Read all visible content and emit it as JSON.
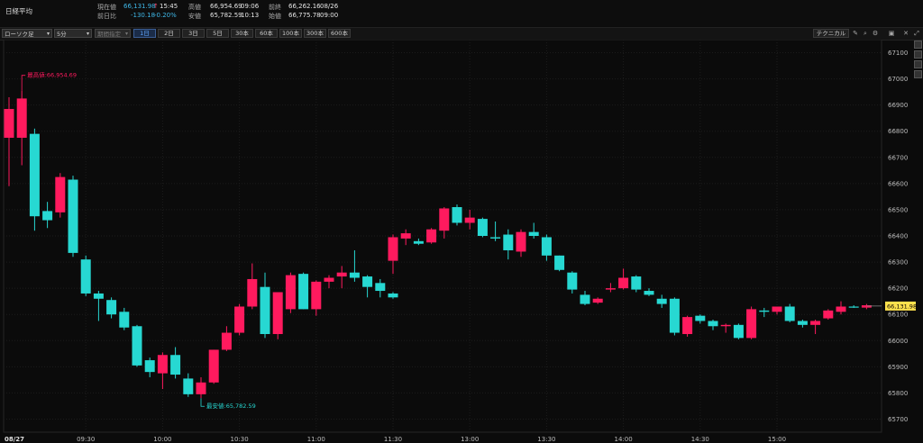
{
  "header": {
    "title": "日経平均",
    "current_label": "現在値",
    "current_value": "66,131.98",
    "current_arrow": "↑",
    "current_time": "15:45",
    "change_label": "前日比",
    "change_value": "-130.18",
    "change_pct": "-0.20%",
    "high_label": "高値",
    "high_value": "66,954.69",
    "high_time": "09:06",
    "low_label": "安値",
    "low_value": "65,782.59",
    "low_time": "10:13",
    "prev_label": "前終",
    "prev_value": "66,262.16",
    "prev_date": "08/26",
    "open_label": "始値",
    "open_value": "66,775.78",
    "open_time": "09:00"
  },
  "toolbar": {
    "chart_type": "ローソク足",
    "interval": "5分",
    "period": "期間指定",
    "ranges": [
      "1日",
      "2日",
      "3日",
      "5日",
      "30本",
      "60本",
      "100本",
      "300本",
      "600本"
    ],
    "active_range": "1日",
    "technical": "テクニカル"
  },
  "colors": {
    "up": "#ff1a5e",
    "down": "#27d8d2",
    "bg": "#0b0b0b",
    "grid": "#1c1c1c",
    "price_tag": "#ffe14d"
  },
  "chart_data": {
    "type": "candlestick",
    "date_label": "08/27",
    "x_ticks": [
      "09:30",
      "10:00",
      "10:30",
      "11:00",
      "11:30",
      "13:00",
      "13:30",
      "14:00",
      "14:30",
      "15:00"
    ],
    "y_ticks": [
      65700,
      65800,
      65900,
      66000,
      66100,
      66200,
      66300,
      66400,
      66500,
      66600,
      66700,
      66800,
      66900,
      67000,
      67100
    ],
    "ylim": [
      65650,
      67150
    ],
    "last_price_label": "66,131.98",
    "last_price": 66131.98,
    "high_annotation": "最高値:66,954.69",
    "low_annotation": "最安値:65,782.59",
    "candles": [
      {
        "t": "09:00",
        "o": 66775,
        "h": 66930,
        "l": 66590,
        "c": 66885
      },
      {
        "t": "09:05",
        "o": 66775,
        "h": 66955,
        "l": 66670,
        "c": 66925
      },
      {
        "t": "09:10",
        "o": 66790,
        "h": 66810,
        "l": 66420,
        "c": 66475
      },
      {
        "t": "09:15",
        "o": 66495,
        "h": 66530,
        "l": 66430,
        "c": 66460
      },
      {
        "t": "09:20",
        "o": 66490,
        "h": 66640,
        "l": 66470,
        "c": 66625
      },
      {
        "t": "09:25",
        "o": 66615,
        "h": 66630,
        "l": 66320,
        "c": 66335
      },
      {
        "t": "09:30",
        "o": 66310,
        "h": 66325,
        "l": 66170,
        "c": 66180
      },
      {
        "t": "09:35",
        "o": 66180,
        "h": 66190,
        "l": 66075,
        "c": 66160
      },
      {
        "t": "09:40",
        "o": 66155,
        "h": 66165,
        "l": 66085,
        "c": 66100
      },
      {
        "t": "09:45",
        "o": 66110,
        "h": 66125,
        "l": 66040,
        "c": 66050
      },
      {
        "t": "09:50",
        "o": 66055,
        "h": 66060,
        "l": 65900,
        "c": 65905
      },
      {
        "t": "09:55",
        "o": 65925,
        "h": 65935,
        "l": 65860,
        "c": 65880
      },
      {
        "t": "10:00",
        "o": 65875,
        "h": 65955,
        "l": 65815,
        "c": 65945
      },
      {
        "t": "10:05",
        "o": 65945,
        "h": 65975,
        "l": 65855,
        "c": 65870
      },
      {
        "t": "10:10",
        "o": 65855,
        "h": 65875,
        "l": 65785,
        "c": 65795
      },
      {
        "t": "10:15",
        "o": 65795,
        "h": 65860,
        "l": 65780,
        "c": 65840
      },
      {
        "t": "10:20",
        "o": 65840,
        "h": 65965,
        "l": 65835,
        "c": 65965
      },
      {
        "t": "10:25",
        "o": 65965,
        "h": 66055,
        "l": 65960,
        "c": 66030
      },
      {
        "t": "10:30",
        "o": 66030,
        "h": 66140,
        "l": 66020,
        "c": 66130
      },
      {
        "t": "10:35",
        "o": 66130,
        "h": 66295,
        "l": 66120,
        "c": 66235
      },
      {
        "t": "10:40",
        "o": 66205,
        "h": 66260,
        "l": 66010,
        "c": 66025
      },
      {
        "t": "10:45",
        "o": 66025,
        "h": 66185,
        "l": 66005,
        "c": 66185
      },
      {
        "t": "10:50",
        "o": 66120,
        "h": 66260,
        "l": 66105,
        "c": 66250
      },
      {
        "t": "10:55",
        "o": 66255,
        "h": 66260,
        "l": 66120,
        "c": 66120
      },
      {
        "t": "11:00",
        "o": 66120,
        "h": 66230,
        "l": 66095,
        "c": 66225
      },
      {
        "t": "11:05",
        "o": 66225,
        "h": 66250,
        "l": 66200,
        "c": 66240
      },
      {
        "t": "11:10",
        "o": 66245,
        "h": 66285,
        "l": 66200,
        "c": 66260
      },
      {
        "t": "11:15",
        "o": 66260,
        "h": 66345,
        "l": 66225,
        "c": 66240
      },
      {
        "t": "11:20",
        "o": 66245,
        "h": 66250,
        "l": 66165,
        "c": 66205
      },
      {
        "t": "11:25",
        "o": 66220,
        "h": 66235,
        "l": 66165,
        "c": 66190
      },
      {
        "t": "11:30",
        "o": 66180,
        "h": 66185,
        "l": 66160,
        "c": 66165
      },
      {
        "t": "12:30",
        "o": 66305,
        "h": 66405,
        "l": 66255,
        "c": 66395
      },
      {
        "t": "12:35",
        "o": 66390,
        "h": 66425,
        "l": 66365,
        "c": 66410
      },
      {
        "t": "12:40",
        "o": 66380,
        "h": 66390,
        "l": 66365,
        "c": 66370
      },
      {
        "t": "12:45",
        "o": 66375,
        "h": 66430,
        "l": 66370,
        "c": 66425
      },
      {
        "t": "12:50",
        "o": 66420,
        "h": 66510,
        "l": 66390,
        "c": 66505
      },
      {
        "t": "12:55",
        "o": 66510,
        "h": 66520,
        "l": 66440,
        "c": 66450
      },
      {
        "t": "13:00",
        "o": 66450,
        "h": 66500,
        "l": 66425,
        "c": 66470
      },
      {
        "t": "13:05",
        "o": 66465,
        "h": 66470,
        "l": 66395,
        "c": 66400
      },
      {
        "t": "13:10",
        "o": 66395,
        "h": 66455,
        "l": 66380,
        "c": 66390
      },
      {
        "t": "13:15",
        "o": 66405,
        "h": 66425,
        "l": 66310,
        "c": 66345
      },
      {
        "t": "13:20",
        "o": 66340,
        "h": 66425,
        "l": 66320,
        "c": 66415
      },
      {
        "t": "13:25",
        "o": 66415,
        "h": 66450,
        "l": 66390,
        "c": 66400
      },
      {
        "t": "13:30",
        "o": 66395,
        "h": 66405,
        "l": 66305,
        "c": 66325
      },
      {
        "t": "13:35",
        "o": 66325,
        "h": 66325,
        "l": 66265,
        "c": 66270
      },
      {
        "t": "13:40",
        "o": 66260,
        "h": 66265,
        "l": 66180,
        "c": 66195
      },
      {
        "t": "13:45",
        "o": 66175,
        "h": 66190,
        "l": 66135,
        "c": 66140
      },
      {
        "t": "13:50",
        "o": 66145,
        "h": 66165,
        "l": 66140,
        "c": 66160
      },
      {
        "t": "13:55",
        "o": 66195,
        "h": 66220,
        "l": 66185,
        "c": 66200
      },
      {
        "t": "14:00",
        "o": 66200,
        "h": 66275,
        "l": 66195,
        "c": 66240
      },
      {
        "t": "14:05",
        "o": 66245,
        "h": 66250,
        "l": 66185,
        "c": 66195
      },
      {
        "t": "14:10",
        "o": 66190,
        "h": 66200,
        "l": 66170,
        "c": 66175
      },
      {
        "t": "14:15",
        "o": 66160,
        "h": 66175,
        "l": 66125,
        "c": 66140
      },
      {
        "t": "14:20",
        "o": 66160,
        "h": 66165,
        "l": 66020,
        "c": 66030
      },
      {
        "t": "14:25",
        "o": 66025,
        "h": 66095,
        "l": 66015,
        "c": 66090
      },
      {
        "t": "14:30",
        "o": 66095,
        "h": 66100,
        "l": 66065,
        "c": 66075
      },
      {
        "t": "14:35",
        "o": 66075,
        "h": 66080,
        "l": 66040,
        "c": 66055
      },
      {
        "t": "14:40",
        "o": 66055,
        "h": 66065,
        "l": 66030,
        "c": 66060
      },
      {
        "t": "14:45",
        "o": 66060,
        "h": 66065,
        "l": 66005,
        "c": 66010
      },
      {
        "t": "14:50",
        "o": 66010,
        "h": 66130,
        "l": 66005,
        "c": 66120
      },
      {
        "t": "14:55",
        "o": 66115,
        "h": 66125,
        "l": 66090,
        "c": 66110
      },
      {
        "t": "15:00",
        "o": 66110,
        "h": 66130,
        "l": 66100,
        "c": 66130
      },
      {
        "t": "15:05",
        "o": 66130,
        "h": 66140,
        "l": 66070,
        "c": 66075
      },
      {
        "t": "15:10",
        "o": 66075,
        "h": 66080,
        "l": 66050,
        "c": 66060
      },
      {
        "t": "15:15",
        "o": 66060,
        "h": 66080,
        "l": 66025,
        "c": 66075
      },
      {
        "t": "15:20",
        "o": 66085,
        "h": 66120,
        "l": 66080,
        "c": 66115
      },
      {
        "t": "15:25",
        "o": 66110,
        "h": 66150,
        "l": 66100,
        "c": 66130
      },
      {
        "t": "15:30",
        "o": 66130,
        "h": 66135,
        "l": 66125,
        "c": 66128
      },
      {
        "t": "15:35",
        "o": 66126,
        "h": 66140,
        "l": 66120,
        "c": 66135
      }
    ]
  }
}
